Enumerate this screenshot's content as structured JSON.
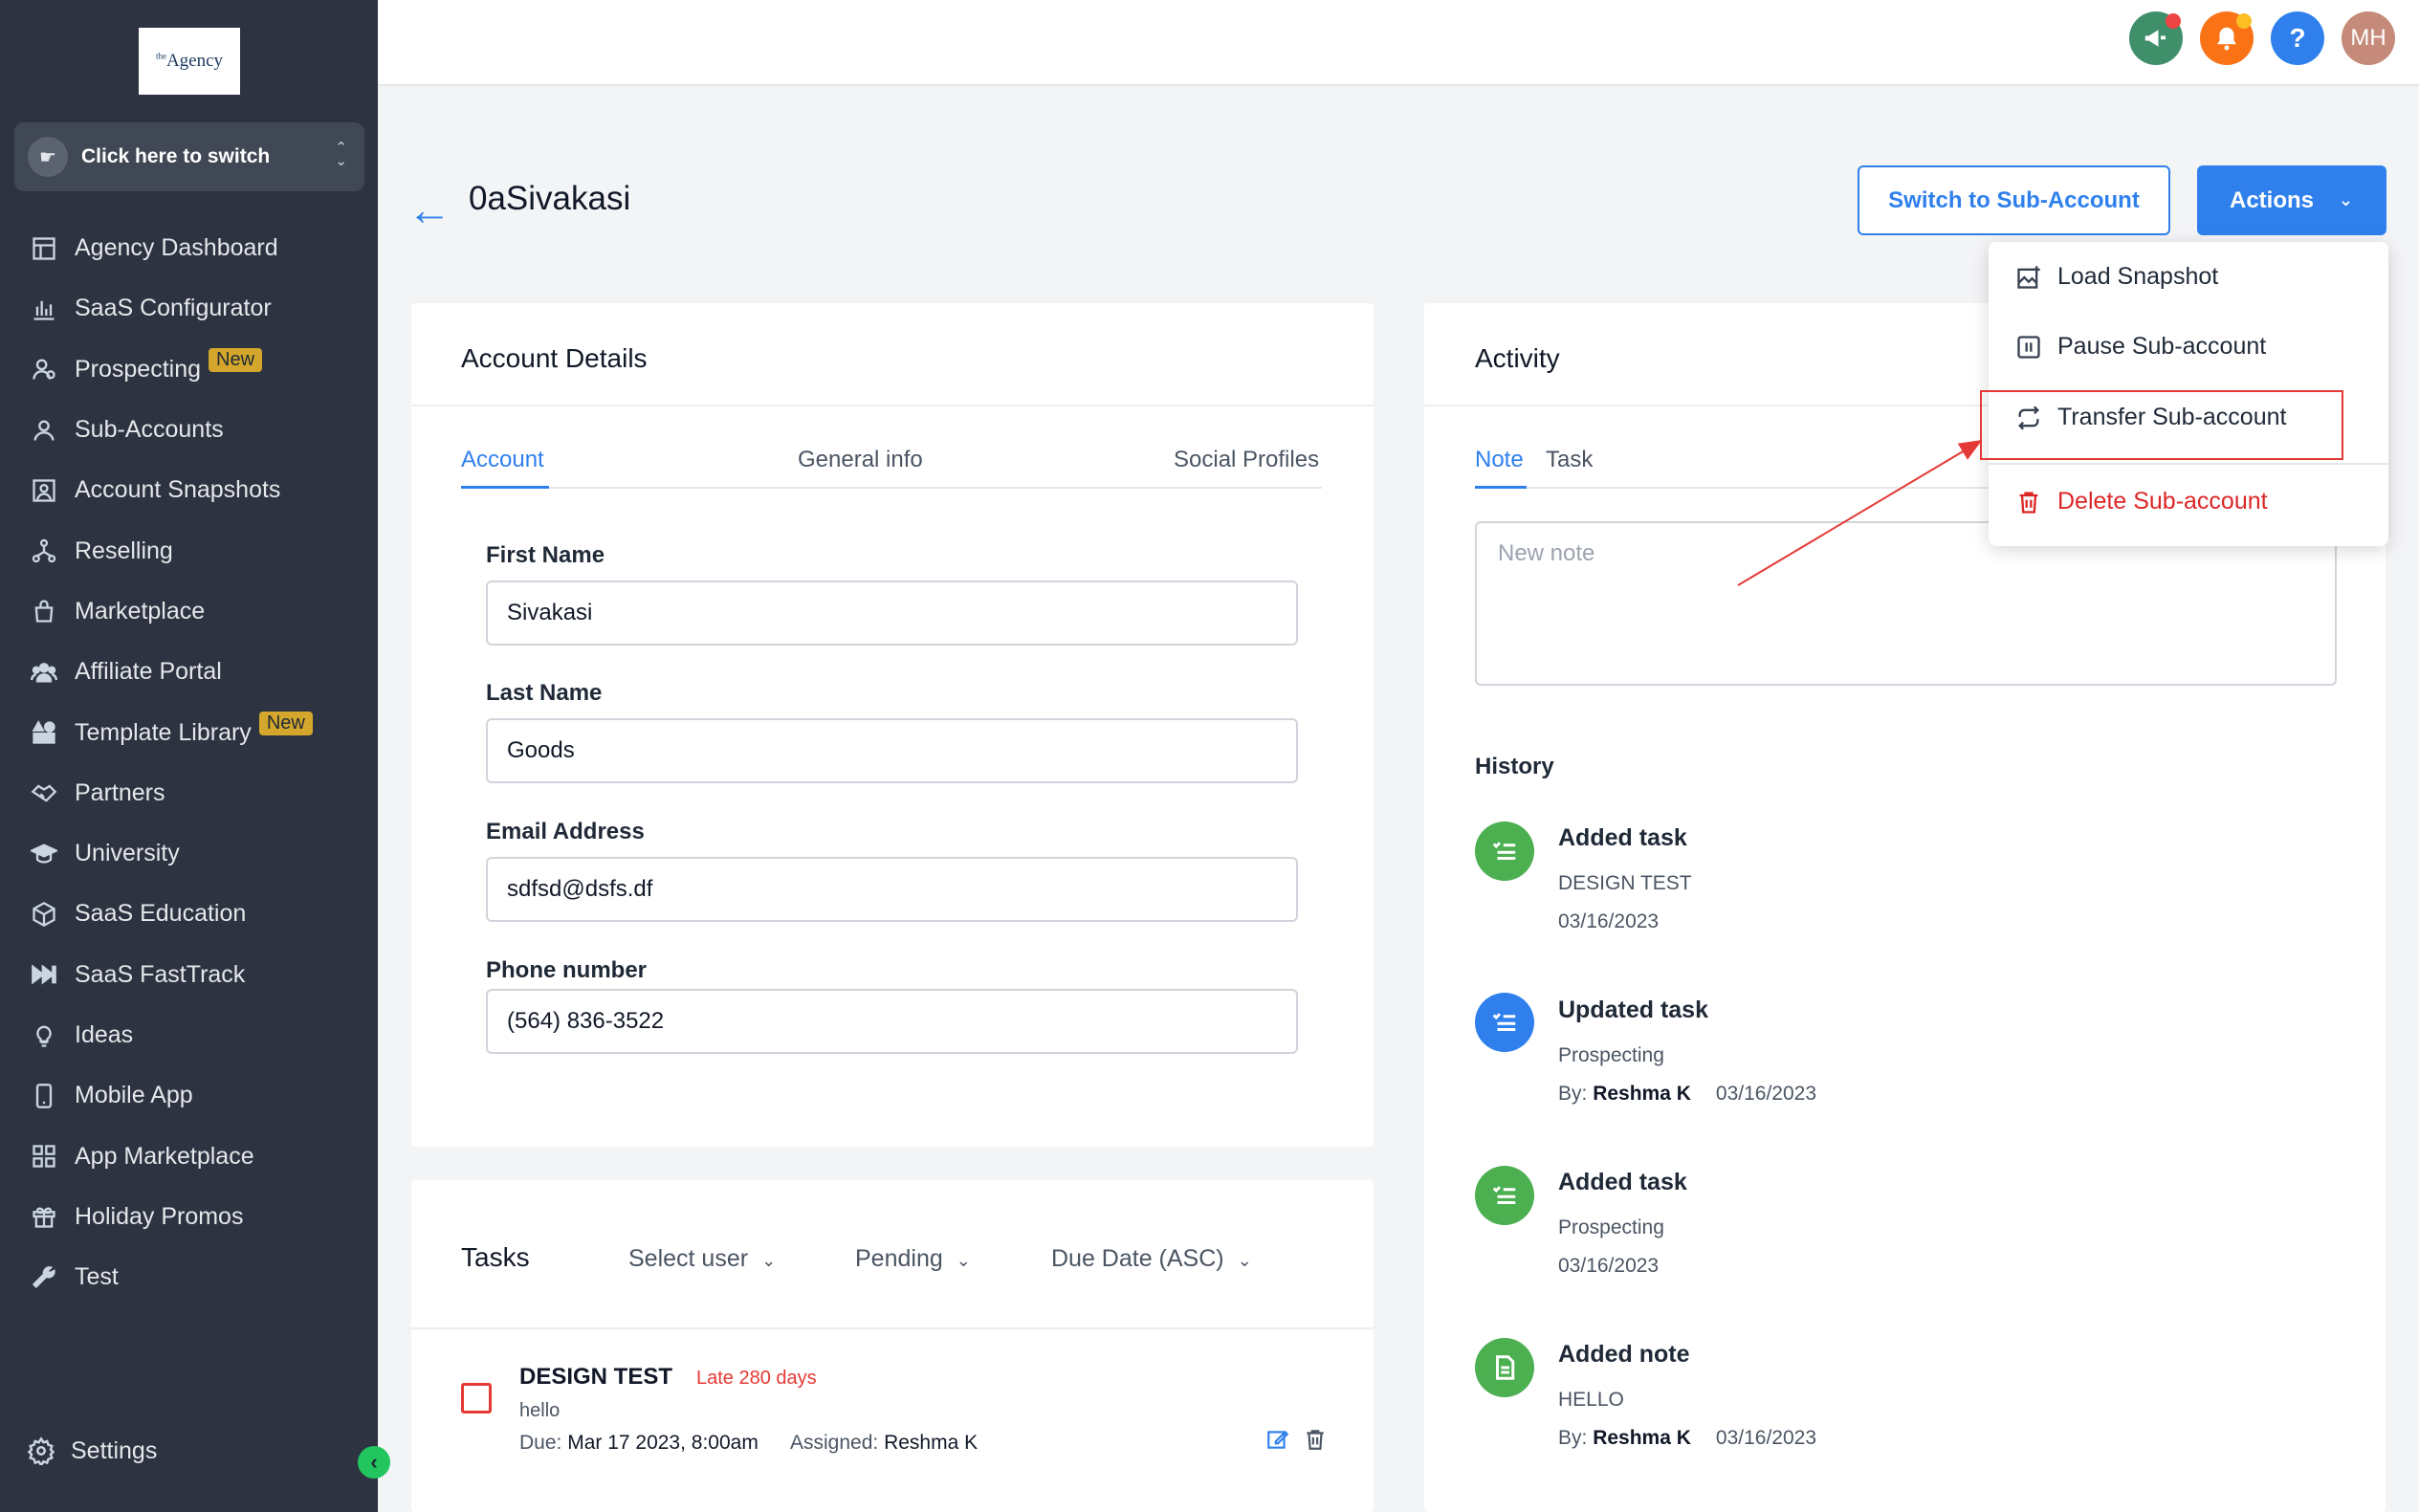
{
  "colors": {
    "sidebar_bg": "#2d3340",
    "accent": "#2f80ed",
    "danger": "#dc2626",
    "new_badge": "#d4a72c",
    "success": "#4caf50"
  },
  "logo": {
    "sup": "the",
    "text": "Agency"
  },
  "switcher": {
    "label": "Click here to switch",
    "icon": "pointer-click-icon"
  },
  "sidebar": {
    "items": [
      {
        "label": "Agency Dashboard",
        "icon": "dashboard-icon"
      },
      {
        "label": "SaaS Configurator",
        "icon": "bar-chart-icon"
      },
      {
        "label": "Prospecting",
        "icon": "prospect-icon",
        "badge": "New"
      },
      {
        "label": "Sub-Accounts",
        "icon": "user-icon"
      },
      {
        "label": "Account Snapshots",
        "icon": "snapshot-icon"
      },
      {
        "label": "Reselling",
        "icon": "network-icon"
      },
      {
        "label": "Marketplace",
        "icon": "bag-icon"
      },
      {
        "label": "Affiliate Portal",
        "icon": "users-icon"
      },
      {
        "label": "Template Library",
        "icon": "shapes-icon",
        "badge": "New"
      },
      {
        "label": "Partners",
        "icon": "handshake-icon"
      },
      {
        "label": "University",
        "icon": "graduation-cap-icon"
      },
      {
        "label": "SaaS Education",
        "icon": "box-icon"
      },
      {
        "label": "SaaS FastTrack",
        "icon": "fast-forward-icon"
      },
      {
        "label": "Ideas",
        "icon": "lightbulb-icon"
      },
      {
        "label": "Mobile App",
        "icon": "mobile-icon"
      },
      {
        "label": "App Marketplace",
        "icon": "grid-icon"
      },
      {
        "label": "Holiday Promos",
        "icon": "gift-icon"
      },
      {
        "label": "Test",
        "icon": "wrench-icon"
      }
    ],
    "settings_label": "Settings"
  },
  "topbar": {
    "avatar_initials": "MH",
    "help": "?"
  },
  "header": {
    "title": "0aSivakasi",
    "switch_button": "Switch to Sub-Account",
    "actions_button": "Actions"
  },
  "actions_menu": {
    "items": [
      {
        "label": "Load Snapshot"
      },
      {
        "label": "Pause Sub-account"
      },
      {
        "label": "Transfer Sub-account"
      },
      {
        "label": "Delete Sub-account"
      }
    ]
  },
  "account_details": {
    "title": "Account Details",
    "tabs": [
      "Account",
      "General info",
      "Social Profiles"
    ],
    "fields": [
      {
        "label": "First Name",
        "value": "Sivakasi"
      },
      {
        "label": "Last Name",
        "value": "Goods"
      },
      {
        "label": "Email Address",
        "value": "sdfsd@dsfs.df"
      },
      {
        "label": "Phone number",
        "value": "(564) 836-3522"
      }
    ]
  },
  "tasks": {
    "title": "Tasks",
    "filters": [
      "Select user",
      "Pending",
      "Due Date (ASC)"
    ],
    "items": [
      {
        "title": "DESIGN TEST",
        "late": "Late 280 days",
        "desc": "hello",
        "due_label": "Due:",
        "due": "Mar 17 2023, 8:00am",
        "assigned_label": "Assigned:",
        "assigned": "Reshma K"
      }
    ]
  },
  "activity": {
    "title": "Activity",
    "tabs": [
      "Note",
      "Task"
    ],
    "note_placeholder": "New note",
    "history_title": "History",
    "history": [
      {
        "title": "Added task",
        "sub": "DESIGN TEST",
        "by_label": "",
        "by": "",
        "date": "03/16/2023",
        "color": "#4caf50"
      },
      {
        "title": "Updated task",
        "sub": "Prospecting",
        "by_label": "By:",
        "by": "Reshma K",
        "date": "03/16/2023",
        "color": "#2f80ed"
      },
      {
        "title": "Added task",
        "sub": "Prospecting",
        "by_label": "",
        "by": "",
        "date": "03/16/2023",
        "color": "#4caf50"
      },
      {
        "title": "Added note",
        "sub": "HELLO",
        "by_label": "By:",
        "by": "Reshma K",
        "date": "03/16/2023",
        "color": "#4caf50"
      }
    ]
  }
}
